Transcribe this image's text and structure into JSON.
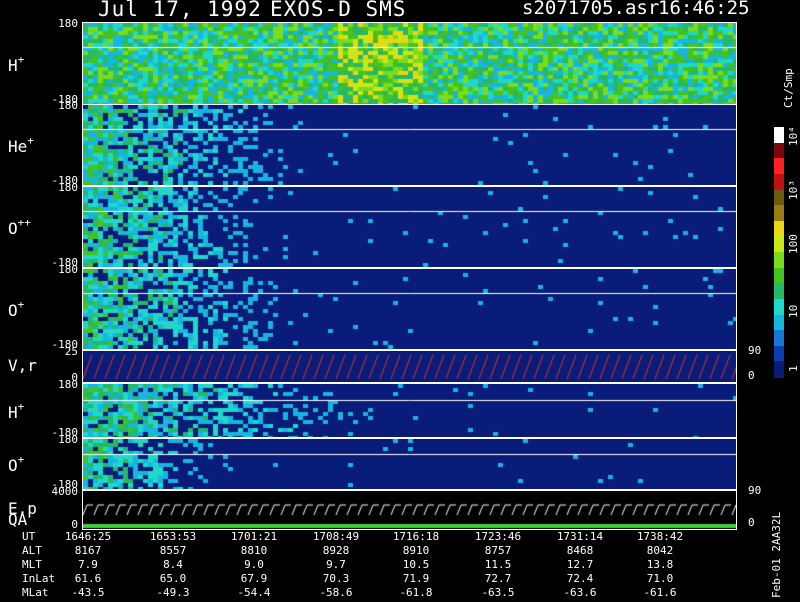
{
  "header": {
    "date": "Jul 17, 1992",
    "instrument": "EXOS-D SMS",
    "file": "s2071705.asr",
    "time": "16:46:25"
  },
  "chart_data": {
    "type": "heatmap",
    "panels": [
      {
        "label": "H",
        "charge": "+",
        "ticks": [
          "180",
          "-180"
        ]
      },
      {
        "label": "He",
        "charge": "+",
        "ticks": [
          "180",
          "-180"
        ]
      },
      {
        "label": "O",
        "charge": "++",
        "ticks": [
          "180",
          "-180"
        ]
      },
      {
        "label": "O",
        "charge": "+",
        "ticks": [
          "180",
          "-180"
        ]
      },
      {
        "label": "V,r",
        "charge": "",
        "ticks": [
          "25",
          "0"
        ],
        "right_ticks": [
          "90",
          "0"
        ]
      },
      {
        "label": "H",
        "charge": "+",
        "ticks": [
          "180",
          "-180"
        ]
      },
      {
        "label": "O",
        "charge": "+",
        "ticks": [
          "180",
          "-180"
        ]
      },
      {
        "label": "E,p",
        "sublabel": "QA",
        "ticks": [
          "4000",
          "0"
        ],
        "right_ticks": [
          "90",
          "0"
        ]
      }
    ],
    "colorbar": {
      "unit": "Ct/Smp",
      "labels": [
        "1",
        "10",
        "100",
        "10³",
        "10⁴"
      ],
      "colors": [
        "#0a1c7a",
        "#0e3fb0",
        "#1577d8",
        "#17b6e0",
        "#1fd8c8",
        "#26b866",
        "#44c21e",
        "#7bdc1a",
        "#c9e81a",
        "#e8d812",
        "#9c7b12",
        "#6e5a10",
        "#c21010",
        "#ff2020",
        "#7a0a0a",
        "#ffffff"
      ]
    },
    "ephemeris": {
      "rows": [
        {
          "label": "UT",
          "values": [
            "1646:25",
            "1653:53",
            "1701:21",
            "1708:49",
            "1716:18",
            "1723:46",
            "1731:14",
            "1738:42"
          ]
        },
        {
          "label": "ALT",
          "values": [
            "8167",
            "8557",
            "8810",
            "8928",
            "8910",
            "8757",
            "8468",
            "8042"
          ]
        },
        {
          "label": "MLT",
          "values": [
            "7.9",
            "8.4",
            "9.0",
            "9.7",
            "10.5",
            "11.5",
            "12.7",
            "13.8"
          ]
        },
        {
          "label": "InLat",
          "values": [
            "61.6",
            "65.0",
            "67.9",
            "70.3",
            "71.9",
            "72.7",
            "72.4",
            "71.0"
          ]
        },
        {
          "label": "MLat",
          "values": [
            "-43.5",
            "-49.3",
            "-54.4",
            "-58.6",
            "-61.8",
            "-63.5",
            "-63.6",
            "-61.6"
          ]
        }
      ]
    },
    "footer_stamp": "Feb-01 2AA32L"
  }
}
